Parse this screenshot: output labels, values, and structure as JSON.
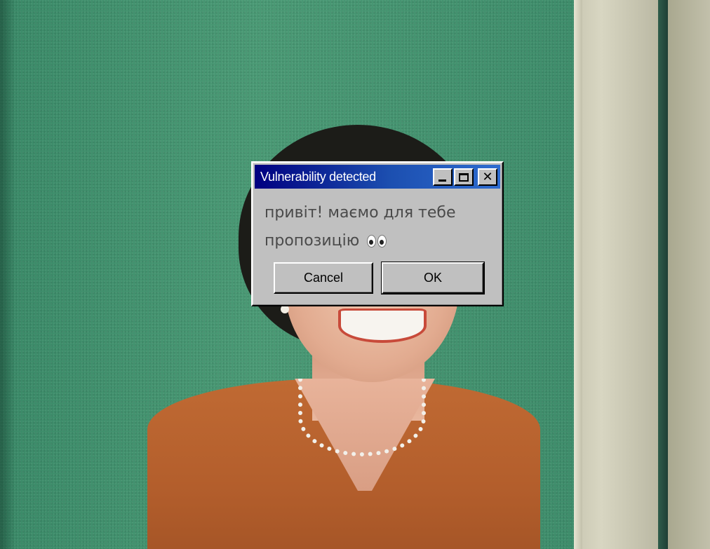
{
  "dialog": {
    "title": "Vulnerability detected",
    "message_line1": "привіт! маємо для тебе",
    "message_line2": "пропозицію",
    "message_emoji": "eyes-emoji",
    "cancel_label": "Cancel",
    "ok_label": "OK",
    "close_glyph": "✕"
  },
  "colors": {
    "titlebar_start": "#000080",
    "titlebar_end": "#2e6cd0",
    "dialog_face": "#c0c0c0",
    "wall_green": "#3f8f6c",
    "dress_orange": "#c06a33"
  }
}
